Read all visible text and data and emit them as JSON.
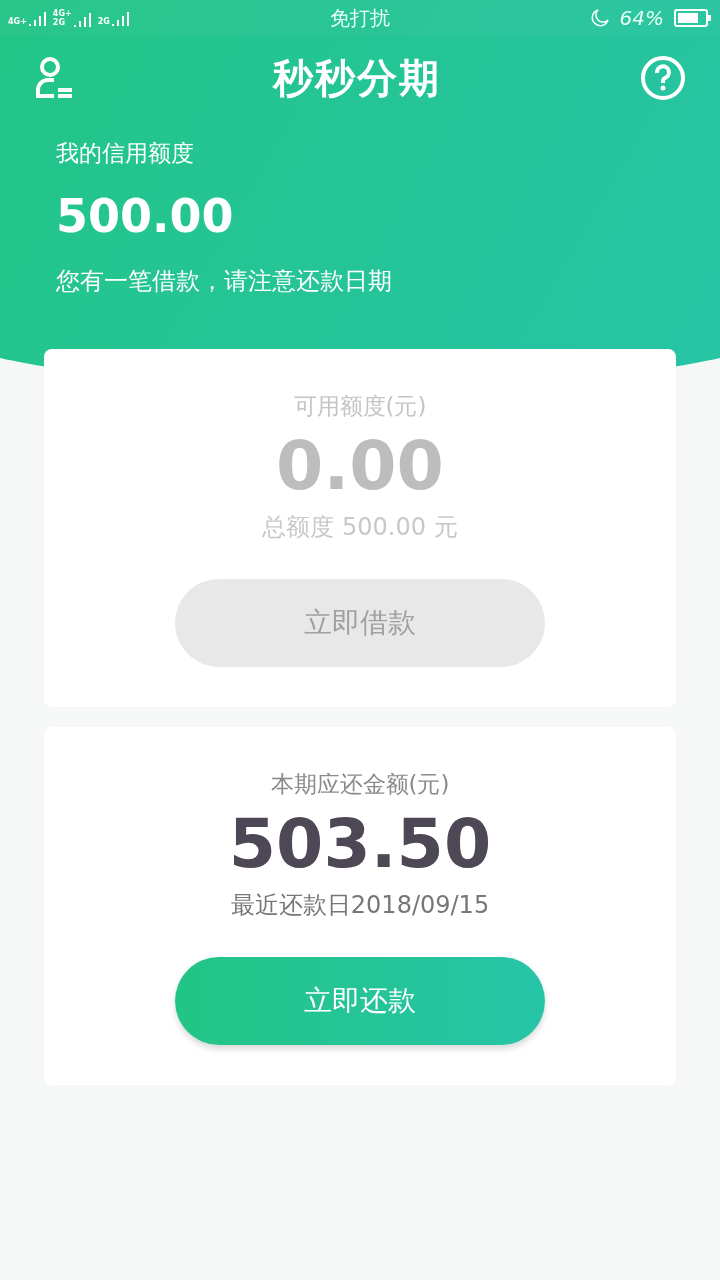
{
  "status_bar": {
    "signals": [
      {
        "label": "4G+"
      },
      {
        "label": "4G+",
        "sub": "2G"
      },
      {
        "label": "2G"
      }
    ],
    "mode": "免打扰",
    "battery": "64%"
  },
  "header": {
    "title": "秒秒分期"
  },
  "credit": {
    "label": "我的信用额度",
    "amount": "500.00",
    "notice": "您有一笔借款，请注意还款日期"
  },
  "cards": [
    {
      "label": "可用额度(元)",
      "amount": "0.00",
      "note": "总额度 500.00 元",
      "button": {
        "label": "立即借款",
        "disabled": true
      }
    },
    {
      "label": "本期应还金额(元)",
      "amount": "503.50",
      "note": "最近还款日2018/09/15",
      "button": {
        "label": "立即还款",
        "disabled": false
      }
    }
  ]
}
